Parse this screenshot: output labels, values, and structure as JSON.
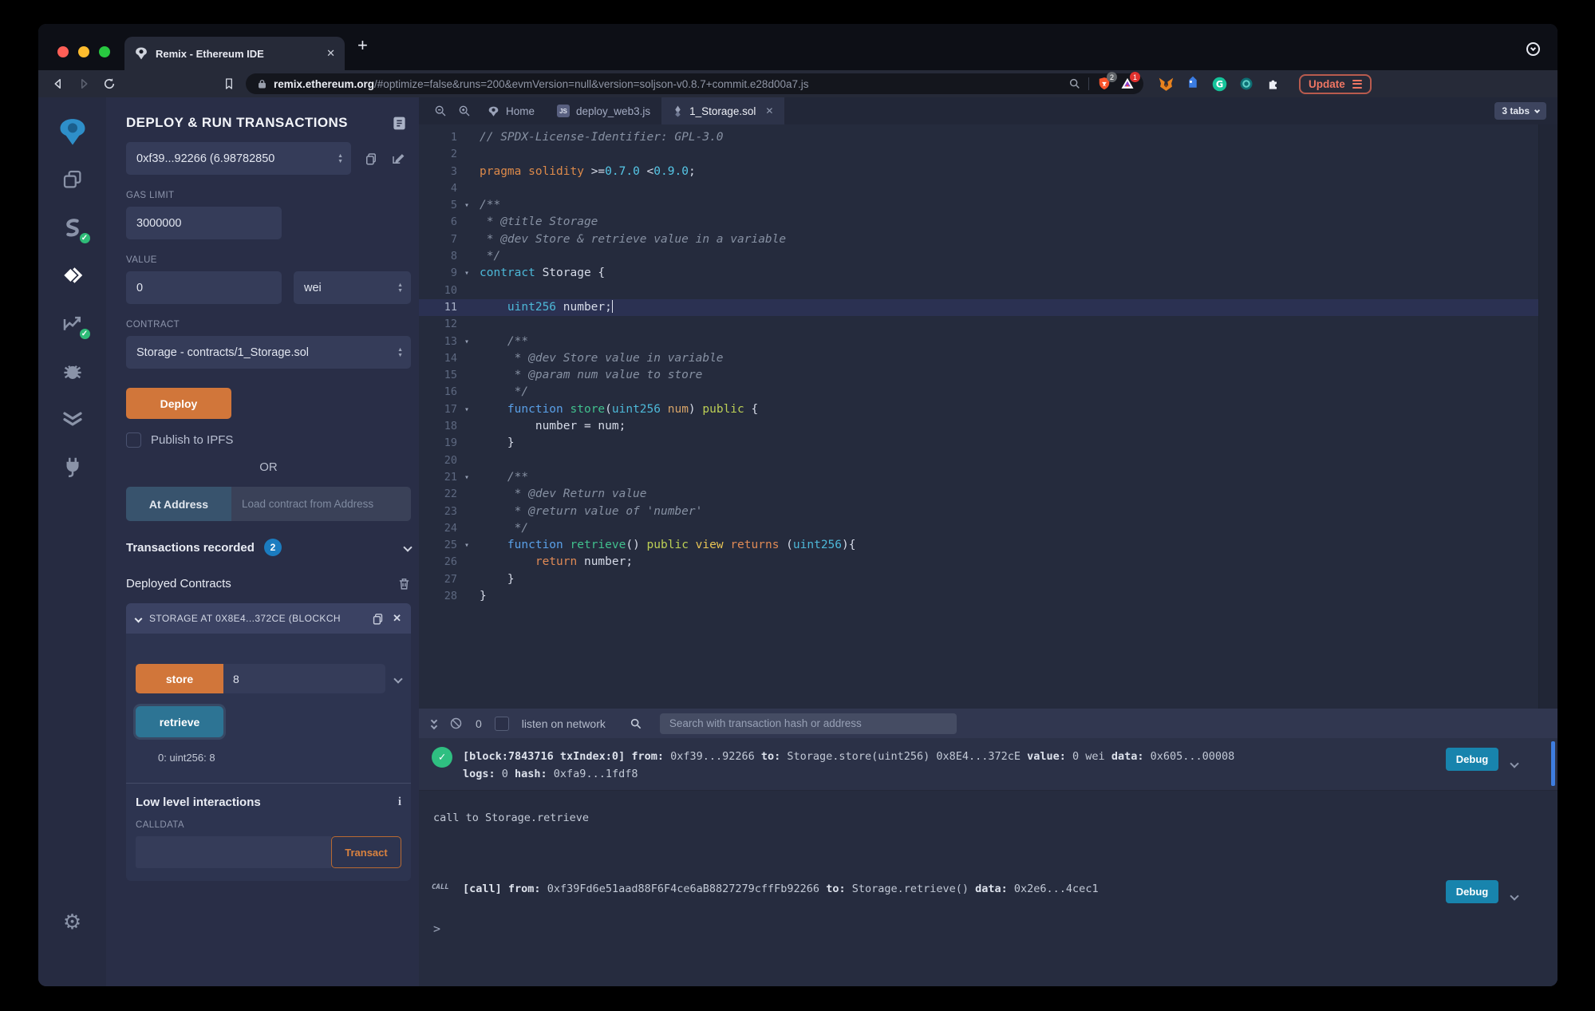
{
  "colors": {
    "accent_orange": "#d1763a",
    "debug_blue": "#1884ad",
    "badge_blue": "#1b7cc0",
    "success_green": "#2fbf81",
    "retrieve_blue": "#2d7494",
    "update_red": "#ef7663"
  },
  "browser": {
    "tab_title": "Remix - Ethereum IDE",
    "new_tab_label": "+",
    "url_domain": "remix.ethereum.org",
    "url_path": "/#optimize=false&runs=200&evmVersion=null&version=soljson-v0.8.7+commit.e28d00a7.js",
    "shield_badge": "2",
    "rewards_badge": "1",
    "update_label": "Update"
  },
  "deploy_panel": {
    "title": "DEPLOY & RUN TRANSACTIONS",
    "account_value": "0xf39...92266 (6.98782850",
    "gas_limit_label": "GAS LIMIT",
    "gas_limit_value": "3000000",
    "value_label": "VALUE",
    "value_value": "0",
    "unit_value": "wei",
    "contract_label": "CONTRACT",
    "contract_value": "Storage - contracts/1_Storage.sol",
    "deploy_label": "Deploy",
    "publish_label": "Publish to IPFS",
    "or_label": "OR",
    "at_address_label": "At Address",
    "at_address_placeholder": "Load contract from Address",
    "transactions_recorded_label": "Transactions recorded",
    "transactions_count": "2",
    "deployed_contracts_label": "Deployed Contracts",
    "contract_card": {
      "header": "STORAGE AT 0X8E4...372CE (BLOCKCH",
      "store_label": "store",
      "store_value": "8",
      "retrieve_label": "retrieve",
      "output_value": "0: uint256: 8",
      "low_level_label": "Low level interactions",
      "calldata_label": "CALLDATA",
      "transact_label": "Transact"
    }
  },
  "editor": {
    "tabs": [
      {
        "label": "Home"
      },
      {
        "label": "deploy_web3.js",
        "icon_text": "JS"
      },
      {
        "label": "1_Storage.sol"
      }
    ],
    "tabs_badge": "3 tabs",
    "code": {
      "lines": [
        {
          "n": 1,
          "tokens": [
            {
              "c": "cm",
              "t": "// SPDX-License-Identifier: GPL-3.0"
            }
          ]
        },
        {
          "n": 2,
          "tokens": []
        },
        {
          "n": 3,
          "tokens": [
            {
              "c": "o1",
              "t": "pragma solidity "
            },
            {
              "c": "pl",
              "t": ">="
            },
            {
              "c": "nu",
              "t": "0.7.0"
            },
            {
              "c": "pl",
              "t": " <"
            },
            {
              "c": "nu",
              "t": "0.9.0"
            },
            {
              "c": "pl",
              "t": ";"
            }
          ]
        },
        {
          "n": 4,
          "tokens": []
        },
        {
          "n": 5,
          "fold": true,
          "tokens": [
            {
              "c": "cm",
              "t": "/**"
            }
          ]
        },
        {
          "n": 6,
          "tokens": [
            {
              "c": "cm",
              "t": " * @title Storage"
            }
          ]
        },
        {
          "n": 7,
          "tokens": [
            {
              "c": "cm",
              "t": " * @dev Store & retrieve value in a variable"
            }
          ]
        },
        {
          "n": 8,
          "tokens": [
            {
              "c": "cm",
              "t": " */"
            }
          ]
        },
        {
          "n": 9,
          "fold": true,
          "tokens": [
            {
              "c": "cy",
              "t": "contract"
            },
            {
              "c": "pl",
              "t": " Storage {"
            }
          ]
        },
        {
          "n": 10,
          "tokens": []
        },
        {
          "n": 11,
          "active": true,
          "cursor": true,
          "tokens": [
            {
              "c": "pl",
              "t": "    "
            },
            {
              "c": "cy",
              "t": "uint256"
            },
            {
              "c": "pl",
              "t": " number;"
            }
          ]
        },
        {
          "n": 12,
          "tokens": []
        },
        {
          "n": 13,
          "fold": true,
          "tokens": [
            {
              "c": "pl",
              "t": "    "
            },
            {
              "c": "cm",
              "t": "/**"
            }
          ]
        },
        {
          "n": 14,
          "tokens": [
            {
              "c": "cm",
              "t": "     * @dev Store value in variable"
            }
          ]
        },
        {
          "n": 15,
          "tokens": [
            {
              "c": "cm",
              "t": "     * @param num value to store"
            }
          ]
        },
        {
          "n": 16,
          "tokens": [
            {
              "c": "cm",
              "t": "     */"
            }
          ]
        },
        {
          "n": 17,
          "fold": true,
          "tokens": [
            {
              "c": "pl",
              "t": "    "
            },
            {
              "c": "bl",
              "t": "function"
            },
            {
              "c": "pl",
              "t": " "
            },
            {
              "c": "fn",
              "t": "store"
            },
            {
              "c": "pl",
              "t": "("
            },
            {
              "c": "cy",
              "t": "uint256"
            },
            {
              "c": "pr",
              "t": " num"
            },
            {
              "c": "pl",
              "t": ") "
            },
            {
              "c": "gr",
              "t": "public"
            },
            {
              "c": "pl",
              "t": " {"
            }
          ]
        },
        {
          "n": 18,
          "tokens": [
            {
              "c": "pl",
              "t": "        number = num;"
            }
          ]
        },
        {
          "n": 19,
          "tokens": [
            {
              "c": "pl",
              "t": "    }"
            }
          ]
        },
        {
          "n": 20,
          "tokens": []
        },
        {
          "n": 21,
          "fold": true,
          "tokens": [
            {
              "c": "pl",
              "t": "    "
            },
            {
              "c": "cm",
              "t": "/**"
            }
          ]
        },
        {
          "n": 22,
          "tokens": [
            {
              "c": "cm",
              "t": "     * @dev Return value"
            }
          ]
        },
        {
          "n": 23,
          "tokens": [
            {
              "c": "cm",
              "t": "     * @return value of 'number'"
            }
          ]
        },
        {
          "n": 24,
          "tokens": [
            {
              "c": "cm",
              "t": "     */"
            }
          ]
        },
        {
          "n": 25,
          "fold": true,
          "tokens": [
            {
              "c": "pl",
              "t": "    "
            },
            {
              "c": "bl",
              "t": "function"
            },
            {
              "c": "pl",
              "t": " "
            },
            {
              "c": "fn",
              "t": "retrieve"
            },
            {
              "c": "pl",
              "t": "() "
            },
            {
              "c": "gr",
              "t": "public"
            },
            {
              "c": "pl",
              "t": " "
            },
            {
              "c": "yl",
              "t": "view"
            },
            {
              "c": "pl",
              "t": " "
            },
            {
              "c": "o2",
              "t": "returns"
            },
            {
              "c": "pl",
              "t": " ("
            },
            {
              "c": "cy",
              "t": "uint256"
            },
            {
              "c": "pl",
              "t": "){"
            }
          ]
        },
        {
          "n": 26,
          "tokens": [
            {
              "c": "pl",
              "t": "        "
            },
            {
              "c": "o2",
              "t": "return"
            },
            {
              "c": "pl",
              "t": " number;"
            }
          ]
        },
        {
          "n": 27,
          "tokens": [
            {
              "c": "pl",
              "t": "    }"
            }
          ]
        },
        {
          "n": 28,
          "tokens": [
            {
              "c": "pl",
              "t": "}"
            }
          ]
        }
      ]
    }
  },
  "terminal": {
    "badge_count": "0",
    "listen_label": "listen on network",
    "search_placeholder": "Search with transaction hash or address",
    "debug_label": "Debug",
    "prompt": ">",
    "entries": [
      {
        "kind": "tx",
        "lines": [
          [
            {
              "b": true,
              "t": "[block:7843716 txIndex:0] "
            },
            {
              "b": true,
              "t": "from:"
            },
            {
              "b": false,
              "t": " 0xf39...92266 "
            },
            {
              "b": true,
              "t": "to:"
            },
            {
              "b": false,
              "t": " Storage.store(uint256) 0x8E4...372cE "
            },
            {
              "b": true,
              "t": "value:"
            },
            {
              "b": false,
              "t": " 0 wei "
            },
            {
              "b": true,
              "t": "data:"
            },
            {
              "b": false,
              "t": " 0x605...00008 "
            }
          ],
          [
            {
              "b": true,
              "t": "logs:"
            },
            {
              "b": false,
              "t": " 0 "
            },
            {
              "b": true,
              "t": "hash:"
            },
            {
              "b": false,
              "t": " 0xfa9...1fdf8"
            }
          ]
        ]
      },
      {
        "kind": "log",
        "text": "call to Storage.retrieve"
      },
      {
        "kind": "call",
        "prefix": "call",
        "lines": [
          [
            {
              "b": true,
              "t": "[call]"
            },
            {
              "b": false,
              "t": " "
            },
            {
              "b": true,
              "t": "from:"
            },
            {
              "b": false,
              "t": " 0xf39Fd6e51aad88F6F4ce6aB8827279cffFb92266 "
            },
            {
              "b": true,
              "t": "to:"
            },
            {
              "b": false,
              "t": " Storage.retrieve() "
            },
            {
              "b": true,
              "t": "data:"
            },
            {
              "b": false,
              "t": " 0x2e6...4cec1"
            }
          ]
        ]
      }
    ]
  }
}
